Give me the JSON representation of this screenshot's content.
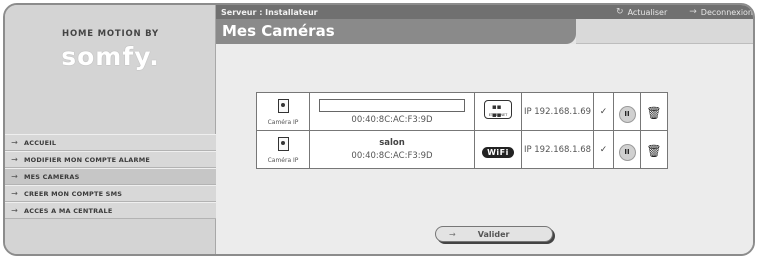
{
  "brand": {
    "top_text": "HOME MOTION BY",
    "logo_text": "somfy."
  },
  "menu": {
    "items": [
      {
        "label": "ACCUEIL"
      },
      {
        "label": "MODIFIER MON COMPTE ALARME"
      },
      {
        "label": "MES CAMERAS"
      },
      {
        "label": "CREER MON COMPTE SMS"
      },
      {
        "label": "ACCES A MA CENTRALE"
      }
    ],
    "arrow": "→"
  },
  "topbar": {
    "server": "Serveur : Installateur",
    "refresh_label": "Actualiser",
    "logout_label": "Deconnexion"
  },
  "page": {
    "title": "Mes Caméras"
  },
  "cameras": [
    {
      "type_label": "Caméra IP",
      "name": "",
      "mac": "00:40:8C:AC:F3:9D",
      "connection": "ethernet",
      "connection_label": "ETHERNET",
      "ip": "IP 192.168.1.69",
      "check": "✓"
    },
    {
      "type_label": "Caméra IP",
      "name": "salon",
      "mac": "00:40:8C:AC:F3:9D",
      "connection": "wifi",
      "connection_label": "WiFi",
      "ip": "IP 192.168.1.68",
      "check": "✓"
    }
  ],
  "actions": {
    "pause_symbol": "II",
    "delete_symbol": "🗑"
  },
  "submit": {
    "label": "Valider"
  }
}
